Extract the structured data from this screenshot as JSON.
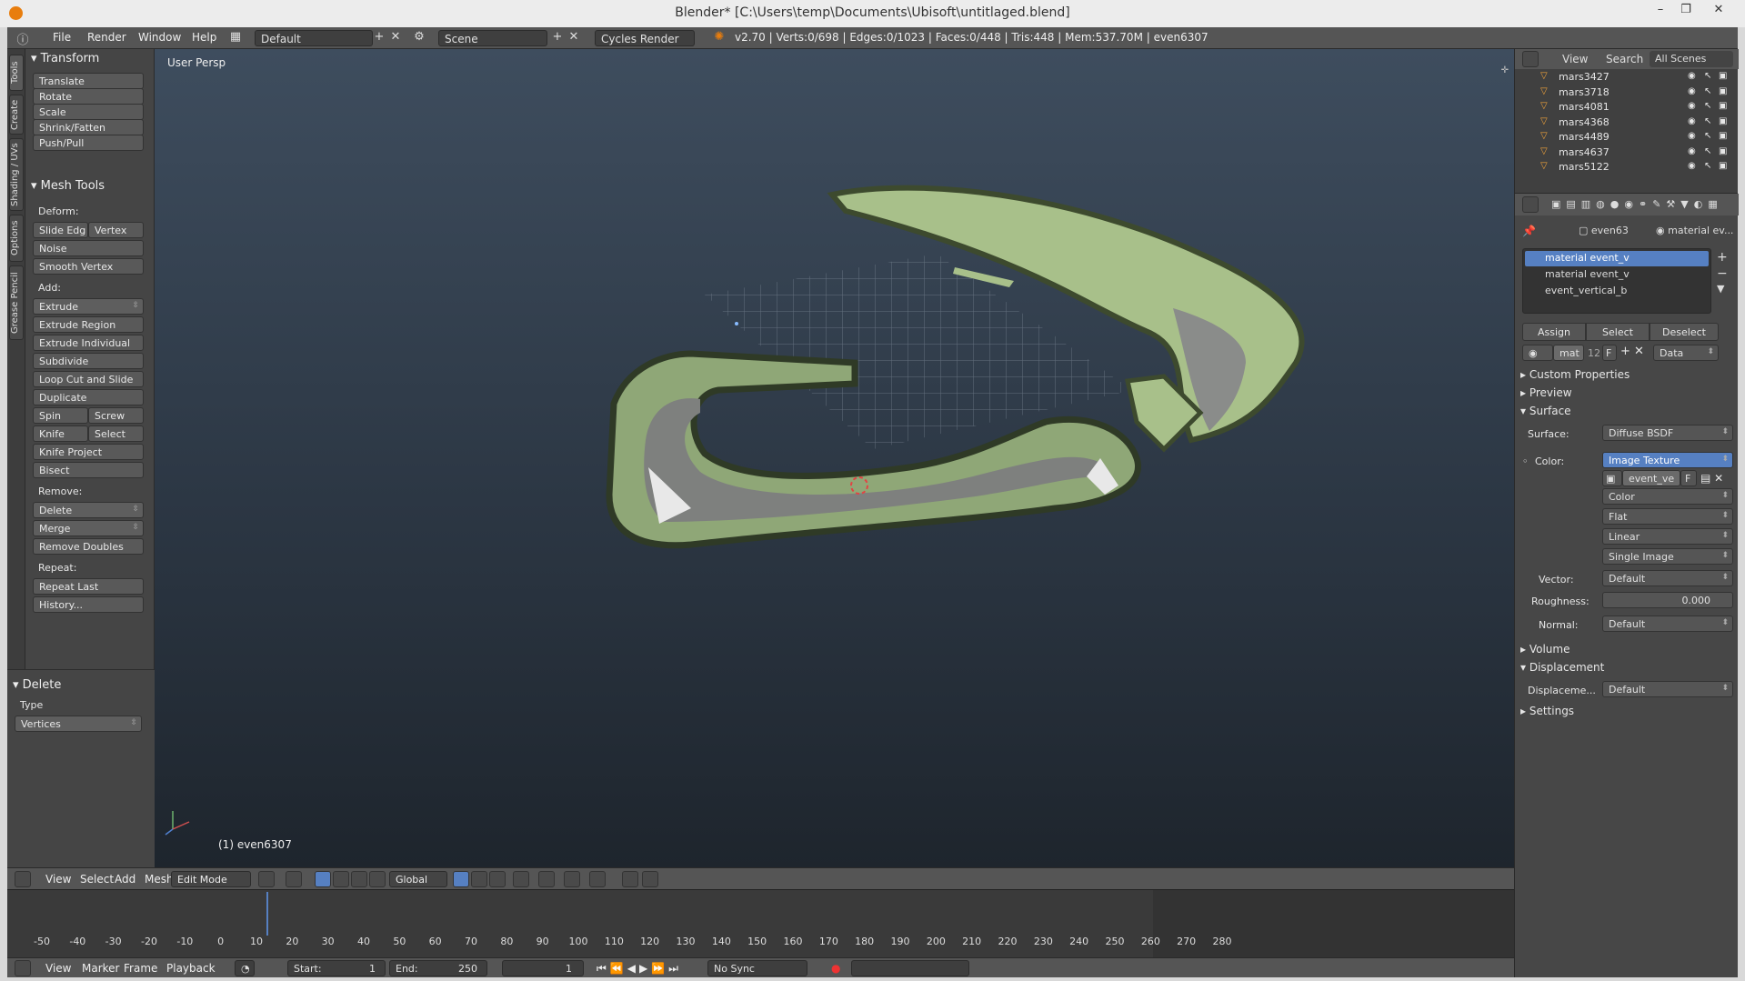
{
  "window": {
    "title": "Blender* [C:\\Users\\temp\\Documents\\Ubisoft\\untitlaged.blend]",
    "minimize": "–",
    "maximize": "❐",
    "close": "✕"
  },
  "info_bar": {
    "menus": [
      "File",
      "Render",
      "Window",
      "Help"
    ],
    "layout": "Default",
    "scene": "Scene",
    "engine": "Cycles Render",
    "stats": "v2.70 | Verts:0/698 | Edges:0/1023 | Faces:0/448 | Tris:448 | Mem:537.70M | even6307"
  },
  "tool_tabs": [
    "Tools",
    "Create",
    "Shading / UVs",
    "Options",
    "Grease Pencil"
  ],
  "tool_shelf": {
    "transform_title": "Transform",
    "transform": [
      "Translate",
      "Rotate",
      "Scale",
      "Shrink/Fatten",
      "Push/Pull"
    ],
    "mesh_tools_title": "Mesh Tools",
    "deform_label": "Deform:",
    "slide_edge": "Slide Edg",
    "vertex": "Vertex",
    "noise": "Noise",
    "smooth_vertex": "Smooth Vertex",
    "add_label": "Add:",
    "extrude": "Extrude",
    "add_items": [
      "Extrude Region",
      "Extrude Individual",
      "Subdivide",
      "Loop Cut and Slide",
      "Duplicate"
    ],
    "spin": "Spin",
    "screw": "Screw",
    "knife": "Knife",
    "select": "Select",
    "knife_project": "Knife Project",
    "bisect": "Bisect",
    "remove_label": "Remove:",
    "delete": "Delete",
    "merge": "Merge",
    "remove_doubles": "Remove Doubles",
    "repeat_label": "Repeat:",
    "repeat_last": "Repeat Last",
    "history": "History...",
    "op_title": "Delete",
    "op_type_label": "Type",
    "op_type_value": "Vertices"
  },
  "viewport": {
    "label": "User Persp",
    "object": "(1) even6307"
  },
  "view3d_header": {
    "menus": [
      "View",
      "Select",
      "Add",
      "Mesh"
    ],
    "mode": "Edit Mode",
    "orientation": "Global"
  },
  "timeline": {
    "ticks": [
      -50,
      -40,
      -30,
      -20,
      -10,
      0,
      10,
      20,
      30,
      40,
      50,
      60,
      70,
      80,
      90,
      100,
      110,
      120,
      130,
      140,
      150,
      160,
      170,
      180,
      190,
      200,
      210,
      220,
      230,
      240,
      250,
      260,
      270,
      280
    ],
    "menus": [
      "View",
      "Marker",
      "Frame",
      "Playback"
    ],
    "start_label": "Start:",
    "start": "1",
    "end_label": "End:",
    "end": "250",
    "current": "1",
    "sync": "No Sync"
  },
  "outliner": {
    "menus": [
      "View",
      "Search"
    ],
    "filter": "All Scenes",
    "objects": [
      "mars3427",
      "mars3718",
      "mars4081",
      "mars4368",
      "mars4489",
      "mars4637",
      "mars5122"
    ]
  },
  "properties": {
    "object_name": "even63",
    "material_name": "material ev...",
    "slots": [
      "material event_v",
      "material event_v",
      "event_vertical_b"
    ],
    "assign": "Assign",
    "select": "Select",
    "deselect": "Deselect",
    "mat_name": "mat",
    "mat_users": "12",
    "fake": "F",
    "link": "Data",
    "custom_props": "Custom Properties",
    "preview": "Preview",
    "surface_title": "Surface",
    "surface_label": "Surface:",
    "surface_value": "Diffuse BSDF",
    "color_label": "Color:",
    "color_value": "Image Texture",
    "image_name": "event_ve",
    "image_fake": "F",
    "tex_color": "Color",
    "tex_proj": "Flat",
    "tex_interp": "Linear",
    "tex_source": "Single Image",
    "vector_label": "Vector:",
    "vector_value": "Default",
    "roughness_label": "Roughness:",
    "roughness_value": "0.000",
    "normal_label": "Normal:",
    "normal_value": "Default",
    "volume": "Volume",
    "displacement_title": "Displacement",
    "displacement_label": "Displaceme...",
    "displacement_value": "Default",
    "settings": "Settings"
  },
  "colors": {
    "accent_blue": "#5680c2",
    "blender_orange": "#e87d0d",
    "terrain_green": "#a8c08a"
  }
}
